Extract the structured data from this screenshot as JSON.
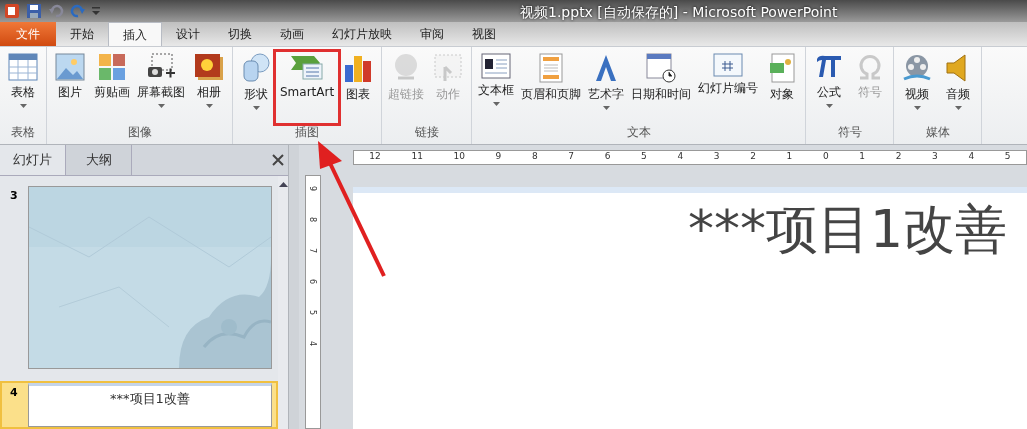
{
  "window": {
    "title": "视频1.pptx [自动保存的]  -  Microsoft PowerPoint"
  },
  "tabs": [
    {
      "label": "文件",
      "kind": "file",
      "selected": false
    },
    {
      "label": "开始",
      "kind": "tab",
      "selected": false
    },
    {
      "label": "插入",
      "kind": "tab",
      "selected": true
    },
    {
      "label": "设计",
      "kind": "tab",
      "selected": false
    },
    {
      "label": "切换",
      "kind": "tab",
      "selected": false
    },
    {
      "label": "动画",
      "kind": "tab",
      "selected": false
    },
    {
      "label": "幻灯片放映",
      "kind": "tab",
      "selected": false
    },
    {
      "label": "审阅",
      "kind": "tab",
      "selected": false
    },
    {
      "label": "视图",
      "kind": "tab",
      "selected": false
    }
  ],
  "ribbon_groups": [
    {
      "label": "表格",
      "items": [
        {
          "label": "表格",
          "dropdown": true,
          "disabled": false,
          "highlighted": false
        }
      ]
    },
    {
      "label": "图像",
      "items": [
        {
          "label": "图片",
          "dropdown": false,
          "disabled": false,
          "highlighted": false
        },
        {
          "label": "剪贴画",
          "dropdown": false,
          "disabled": false,
          "highlighted": false
        },
        {
          "label": "屏幕截图",
          "dropdown": true,
          "disabled": false,
          "highlighted": false
        },
        {
          "label": "相册",
          "dropdown": true,
          "disabled": false,
          "highlighted": false
        }
      ]
    },
    {
      "label": "插图",
      "items": [
        {
          "label": "形状",
          "dropdown": true,
          "disabled": false,
          "highlighted": false
        },
        {
          "label": "SmartArt",
          "dropdown": false,
          "disabled": false,
          "highlighted": true
        },
        {
          "label": "图表",
          "dropdown": false,
          "disabled": false,
          "highlighted": false
        }
      ]
    },
    {
      "label": "链接",
      "items": [
        {
          "label": "超链接",
          "dropdown": false,
          "disabled": true,
          "highlighted": false
        },
        {
          "label": "动作",
          "dropdown": false,
          "disabled": true,
          "highlighted": false
        }
      ]
    },
    {
      "label": "文本",
      "items": [
        {
          "label": "文本框",
          "dropdown": true,
          "disabled": false,
          "highlighted": false
        },
        {
          "label": "页眉和页脚",
          "dropdown": false,
          "disabled": false,
          "highlighted": false
        },
        {
          "label": "艺术字",
          "dropdown": true,
          "disabled": false,
          "highlighted": false
        },
        {
          "label": "日期和时间",
          "dropdown": false,
          "disabled": false,
          "highlighted": false
        },
        {
          "label": "幻灯片编号",
          "dropdown": false,
          "disabled": false,
          "highlighted": false
        },
        {
          "label": "对象",
          "dropdown": false,
          "disabled": false,
          "highlighted": false
        }
      ]
    },
    {
      "label": "符号",
      "items": [
        {
          "label": "公式",
          "dropdown": true,
          "disabled": false,
          "highlighted": false
        },
        {
          "label": "符号",
          "dropdown": false,
          "disabled": true,
          "highlighted": false
        }
      ]
    },
    {
      "label": "媒体",
      "items": [
        {
          "label": "视频",
          "dropdown": true,
          "disabled": false,
          "highlighted": false
        },
        {
          "label": "音频",
          "dropdown": true,
          "disabled": false,
          "highlighted": false
        }
      ]
    }
  ],
  "panel_tabs": [
    {
      "label": "幻灯片",
      "selected": true
    },
    {
      "label": "大纲",
      "selected": false
    }
  ],
  "slides": [
    {
      "number": "3",
      "kind": "picture",
      "selected": false
    },
    {
      "number": "4",
      "kind": "title",
      "title": "***项目1改善",
      "selected": true
    }
  ],
  "ruler": {
    "horizontal": [
      "12",
      "11",
      "10",
      "9",
      "8",
      "7",
      "6",
      "5",
      "4",
      "3",
      "2",
      "1",
      "0",
      "1",
      "2",
      "3",
      "4",
      "5"
    ],
    "vertical": [
      "9",
      "8",
      "7",
      "6",
      "5",
      "4"
    ]
  },
  "slide": {
    "title": "***项目1改善"
  }
}
